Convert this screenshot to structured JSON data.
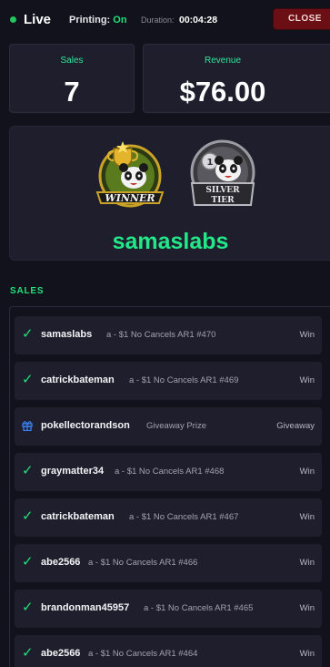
{
  "header": {
    "live_label": "Live",
    "printing_label": "Printing:",
    "printing_value": "On",
    "duration_label": "Duration:",
    "duration_value": "00:04:28",
    "close_label": "CLOSE"
  },
  "stats": {
    "sales_label": "Sales",
    "sales_value": "7",
    "revenue_label": "Revenue",
    "revenue_value": "$76.00"
  },
  "winner": {
    "name": "samaslabs",
    "badges": [
      {
        "icon": "winner-badge-icon",
        "text": "WINNER"
      },
      {
        "icon": "silver-tier-badge-icon",
        "text": "SILVER TIER"
      }
    ]
  },
  "sales": {
    "header": "SALES",
    "rows": [
      {
        "icon": "check-icon",
        "user": "samaslabs",
        "item": "a - $1 No Cancels AR1 #470",
        "kind": "Win"
      },
      {
        "icon": "check-icon",
        "user": "catrickbateman",
        "item": "a - $1 No Cancels AR1 #469",
        "kind": "Win"
      },
      {
        "icon": "gift-icon",
        "user": "pokellectorandson",
        "item": "Giveaway Prize",
        "kind": "Giveaway"
      },
      {
        "icon": "check-icon",
        "user": "graymatter34",
        "item": "a - $1 No Cancels AR1 #468",
        "kind": "Win"
      },
      {
        "icon": "check-icon",
        "user": "catrickbateman",
        "item": "a - $1 No Cancels AR1 #467",
        "kind": "Win"
      },
      {
        "icon": "check-icon",
        "user": "abe2566",
        "item": "a - $1 No Cancels AR1 #466",
        "kind": "Win"
      },
      {
        "icon": "check-icon",
        "user": "brandonman45957",
        "item": "a - $1 No Cancels AR1 #465",
        "kind": "Win"
      },
      {
        "icon": "check-icon",
        "user": "abe2566",
        "item": "a - $1 No Cancels AR1 #464",
        "kind": "Win"
      }
    ]
  },
  "colors": {
    "accent_green": "#22e07a",
    "close_red": "#6b0f14",
    "panel": "#1e1e2c",
    "background": "#12121c"
  }
}
